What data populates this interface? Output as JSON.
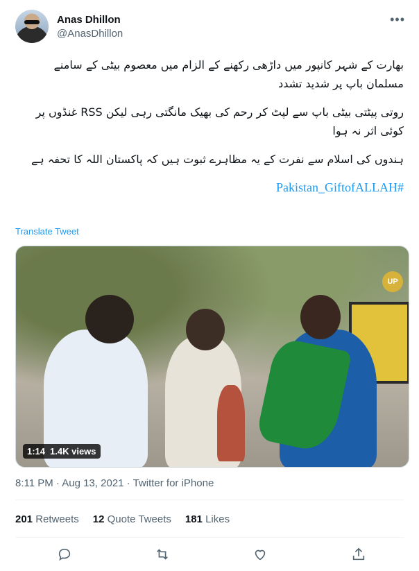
{
  "author": {
    "name": "Anas Dhillon",
    "handle": "@AnasDhillon"
  },
  "tweet": {
    "paragraphs": [
      "بھارت کے شہر کانپور میں داڑھی رکھنے کے الزام میں معصوم بیٹی کے سامنے مسلمان باپ پر شدید تشدد",
      "روتی پیٹتی بیٹی باپ سے لپٹ کر رحم کی بھیک مانگتی رہی لیکن RSS غنڈوں پر کوئی اثر نہ ہوا",
      "ہندوں کی اسلام سے نفرت کے یہ مظاہرے ثبوت ہیں کہ پاکستان اللہ کا تحفہ ہے"
    ],
    "hashtag": "Pakistan_GiftofALLAH#"
  },
  "translate_label": "Translate Tweet",
  "video": {
    "duration": "1:14",
    "views": "1.4K views",
    "channel_logo": "UP"
  },
  "meta": {
    "time": "8:11 PM",
    "date": "Aug 13, 2021",
    "source": "Twitter for iPhone"
  },
  "stats": [
    {
      "count": "201",
      "label": "Retweets"
    },
    {
      "count": "12",
      "label": "Quote Tweets"
    },
    {
      "count": "181",
      "label": "Likes"
    }
  ],
  "icons": [
    "more-icon",
    "reply-icon",
    "retweet-icon",
    "like-icon",
    "share-icon"
  ],
  "colors": {
    "link": "#1d9bf0",
    "secondary": "#536471",
    "primary": "#0f1419"
  }
}
